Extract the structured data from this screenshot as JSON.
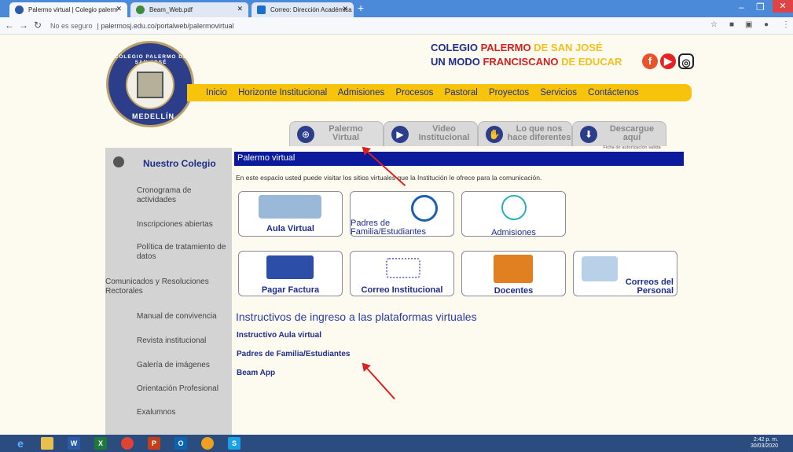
{
  "browser": {
    "tabs": [
      {
        "title": "Palermo virtual | Colegio palerm",
        "icon": "school-icon"
      },
      {
        "title": "Beam_Web.pdf",
        "icon": "chrome-icon"
      },
      {
        "title": "Correo: Dirección Académica Pr",
        "icon": "outlook-icon"
      }
    ],
    "url_security": "No es seguro",
    "url": "palermosj.edu.co/portalweb/palermovirtual"
  },
  "header": {
    "logo_top": "COLEGIO PALERMO DE SAN JOSÉ",
    "logo_bottom": "MEDELLÍN",
    "slogan_line1_a": "COLEGIO ",
    "slogan_line1_b": "PALERMO",
    "slogan_line1_c": " DE SAN JOSÉ",
    "slogan_line2_a": "UN MODO ",
    "slogan_line2_b": "FRANCISCANO",
    "slogan_line2_c": " DE EDUCAR"
  },
  "menu": [
    "Inicio",
    "Horizonte Institucional",
    "Admisiones",
    "Procesos",
    "Pastoral",
    "Proyectos",
    "Servicios",
    "Contáctenos"
  ],
  "tabs": [
    {
      "line1": "Palermo",
      "line2": "Virtual"
    },
    {
      "line1": "Video",
      "line2": "Institucional"
    },
    {
      "line1": "Lo que nos",
      "line2": "hace diferentes"
    },
    {
      "line1": "Descargue aquí",
      "line2": "Ficha de autorización salida estudiantes"
    }
  ],
  "sidebar": {
    "title": "Nuestro Colegio",
    "items": [
      "Cronograma de actividades",
      "Inscripciones abiertas",
      "Política de tratamiento de datos",
      "Comunicados y Resoluciones Rectorales",
      "Manual de convivencia",
      "Revista institucional",
      "Galería de imágenes",
      "Orientación Profesional",
      "Exalumnos"
    ]
  },
  "main": {
    "heading": "Palermo virtual",
    "intro": "En este espacio usted puede visitar los sitios virtuales que la Institución le ofrece para la comunicación.",
    "cards": [
      "Aula Virtual",
      "Padres de Familia/Estudiantes",
      "Admisiones",
      "Pagar Factura",
      "Correo Institucional",
      "Docentes",
      "Correos del Personal"
    ],
    "instructivos_title": "Instructivos de ingreso a las plataformas virtuales",
    "links": [
      "Instructivo Aula virtual",
      "Padres de Familia/Estudiantes",
      "Beam App"
    ]
  },
  "taskbar": {
    "time": "2:42 p. m.",
    "date": "30/03/2020"
  },
  "colors": {
    "menu_bar": "#f7c40b",
    "navy": "#1e2d8a",
    "heading_bar": "#0a1a9a",
    "sidebar": "#d3d3d3",
    "arrow": "#e02020"
  }
}
